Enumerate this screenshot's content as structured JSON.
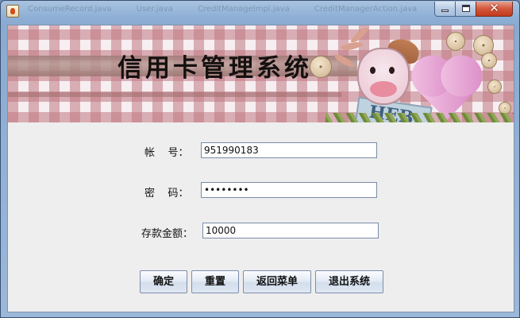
{
  "window": {
    "title": "",
    "background_tabs": [
      "ConsumeRecord.java",
      "User.java",
      "CreditManageImpl.java",
      "CreditManagerAction.java"
    ],
    "controls": {
      "minimize": "minimize",
      "maximize": "maximize",
      "close": "close"
    }
  },
  "banner": {
    "title": "信用卡管理系统",
    "tag_text": "HEB"
  },
  "form": {
    "account": {
      "label": "帐    号：",
      "value": "951990183"
    },
    "password": {
      "label": "密    码：",
      "value": "••••••••"
    },
    "amount": {
      "label": "存款金额：",
      "value": "10000"
    }
  },
  "buttons": {
    "confirm": "确定",
    "reset": "重置",
    "back_menu": "返回菜单",
    "exit": "退出系统"
  },
  "colors": {
    "title_bar": "#8fb0d6",
    "close_button": "#d3573b",
    "client_background": "#eeeeee"
  },
  "icons": {
    "app_icon": "java-cup-icon",
    "minimize": "minimize-icon",
    "maximize": "maximize-icon",
    "close": "close-icon"
  }
}
